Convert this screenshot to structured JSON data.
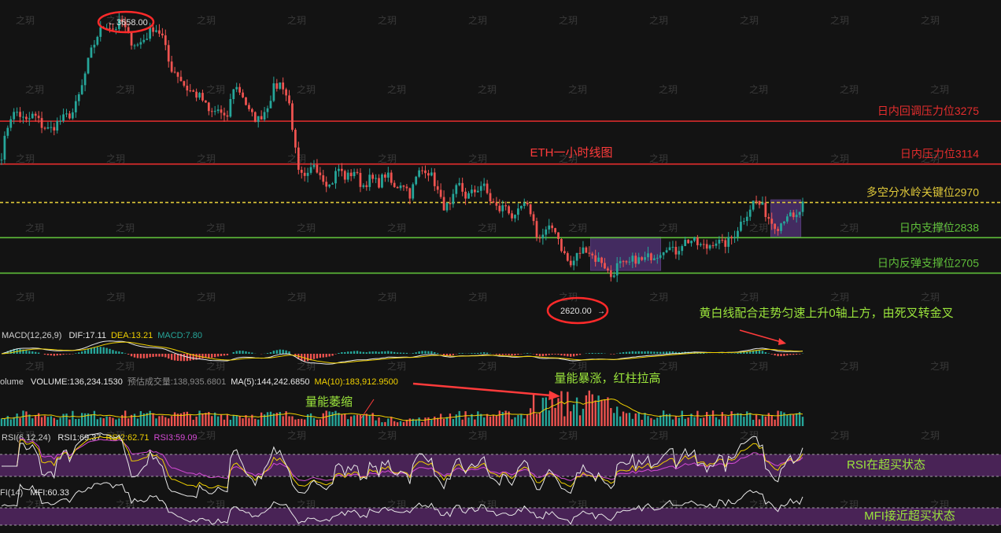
{
  "colors": {
    "background": "#131313",
    "up": "#26a69a",
    "down": "#ef5350",
    "resistance": "#e52d2d",
    "support": "#5fbf3a",
    "key_level": "#e0c93a",
    "annotation_red": "#ff3b3b",
    "annotation_green": "#9be53c",
    "zone": "#6b3fa0",
    "dif_line": "#f0d000",
    "dea_line": "#e8e8e8",
    "rsi_band": "#5c2a6e"
  },
  "chart_data": {
    "type": "candlestick",
    "title": "ETH一小时线图",
    "price_ylim": [
      2550,
      3700
    ],
    "candles_approx_close": [
      3150,
      3290,
      3310,
      3270,
      3300,
      3260,
      3240,
      3270,
      3290,
      3310,
      3400,
      3520,
      3600,
      3640,
      3620,
      3650,
      3580,
      3560,
      3590,
      3630,
      3600,
      3480,
      3450,
      3400,
      3380,
      3360,
      3300,
      3320,
      3270,
      3410,
      3380,
      3300,
      3280,
      3320,
      3400,
      3420,
      3330,
      3080,
      3050,
      3120,
      3070,
      3030,
      3100,
      3060,
      3090,
      3030,
      3060,
      3040,
      3080,
      3020,
      3050,
      3000,
      3080,
      3100,
      3050,
      2960,
      2950,
      3040,
      2990,
      3010,
      3040,
      2980,
      2940,
      2960,
      2900,
      2960,
      2940,
      2830,
      2860,
      2880,
      2790,
      2730,
      2780,
      2800,
      2760,
      2750,
      2690,
      2740,
      2730,
      2760,
      2750,
      2770,
      2780,
      2810,
      2780,
      2820,
      2830,
      2810,
      2800,
      2830,
      2810,
      2830,
      2880,
      2930,
      2980,
      2950,
      2900,
      2880,
      2930,
      2900,
      2960
    ],
    "price_labels": {
      "high": "3658.00",
      "low": "2620.00"
    },
    "levels": [
      {
        "name": "日内回调压力位3275",
        "value": 3275,
        "color": "resistance"
      },
      {
        "name": "日内压力位3114",
        "value": 3114,
        "color": "resistance"
      },
      {
        "name": "多空分水岭关键位2970",
        "value": 2970,
        "color": "key_level"
      },
      {
        "name": "日内支撑位2838",
        "value": 2838,
        "color": "support"
      },
      {
        "name": "日内反弹支撑位2705",
        "value": 2705,
        "color": "support"
      }
    ],
    "zones": [
      {
        "x_from": 0.59,
        "x_to": 0.66,
        "low": 2715,
        "high": 2840
      },
      {
        "x_from": 0.77,
        "x_to": 0.8,
        "low": 2840,
        "high": 2980
      }
    ],
    "indicators": {
      "macd": {
        "label": "MACD(12,26,9)",
        "values": [
          {
            "label": "DIF:17.11",
            "color": "dea_line"
          },
          {
            "label": "DEA:13.21",
            "color": "dif_line"
          },
          {
            "label": "MACD:7.80",
            "color": "up"
          }
        ],
        "annotation": "黄白线配合走势匀速上升0轴上方，由死叉转金叉"
      },
      "volume": {
        "label": "olume",
        "values": [
          {
            "label": "VOLUME:136,234.1530",
            "color": "dea_line"
          },
          {
            "label": "预估成交量:138,935.6801",
            "color": "muted"
          },
          {
            "label": "MA(5):144,242.6850",
            "color": "dea_line"
          },
          {
            "label": "MA(10):183,912.9500",
            "color": "dif_line"
          }
        ],
        "annotations": [
          "量能萎缩",
          "量能暴涨，红柱拉高"
        ]
      },
      "rsi": {
        "label": "RSI(6,12,24)",
        "values": [
          {
            "label": "RSI1:69.37",
            "color": "dea_line"
          },
          {
            "label": "RSI2:62.71",
            "color": "dif_line"
          },
          {
            "label": "RSI3:59.09",
            "color": "rsi3"
          }
        ],
        "annotation": "RSI在超买状态"
      },
      "mfi": {
        "label": "FI(14)",
        "values": [
          {
            "label": "MFI:60.33",
            "color": "dea_line"
          }
        ],
        "annotation": "MFI接近超买状态"
      }
    },
    "watermark": "之玥"
  }
}
